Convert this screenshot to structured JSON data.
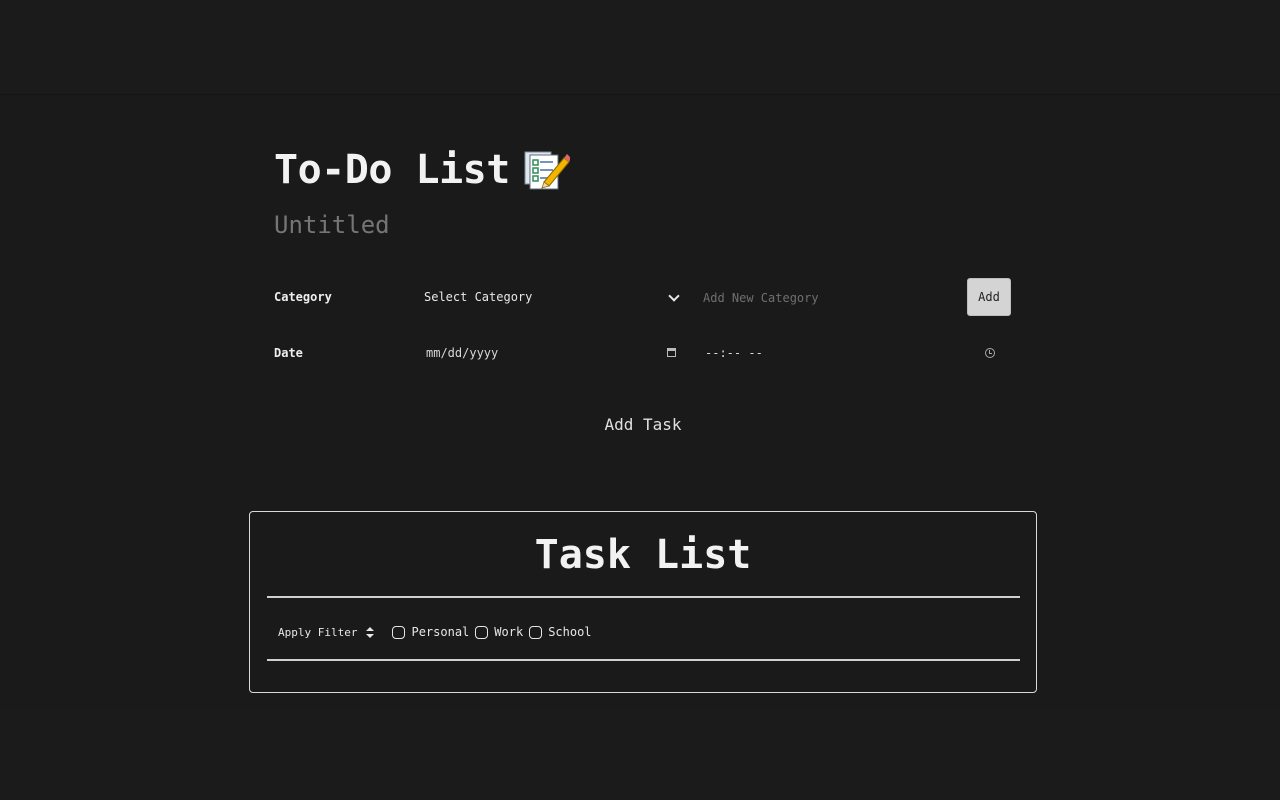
{
  "header": {
    "title": "To-Do List",
    "title_icon": "memo-icon",
    "subtitle_placeholder": "Untitled"
  },
  "form": {
    "category_label": "Category",
    "category_select": {
      "selected": "Select Category"
    },
    "new_category_placeholder": "Add New Category",
    "add_button_label": "Add",
    "date_label": "Date",
    "date_placeholder": "mm/dd/yyyy",
    "time_placeholder": "--:-- --",
    "add_task_label": "Add Task"
  },
  "task_list": {
    "title": "Task List",
    "filter_label": "Apply Filter",
    "filters": [
      {
        "label": "Personal",
        "checked": false
      },
      {
        "label": "Work",
        "checked": false
      },
      {
        "label": "School",
        "checked": false
      }
    ]
  },
  "colors": {
    "background": "#1a1a1a",
    "text": "#f2f2f2",
    "muted": "#7a7a7a",
    "button_bg": "#d4d4d4"
  }
}
